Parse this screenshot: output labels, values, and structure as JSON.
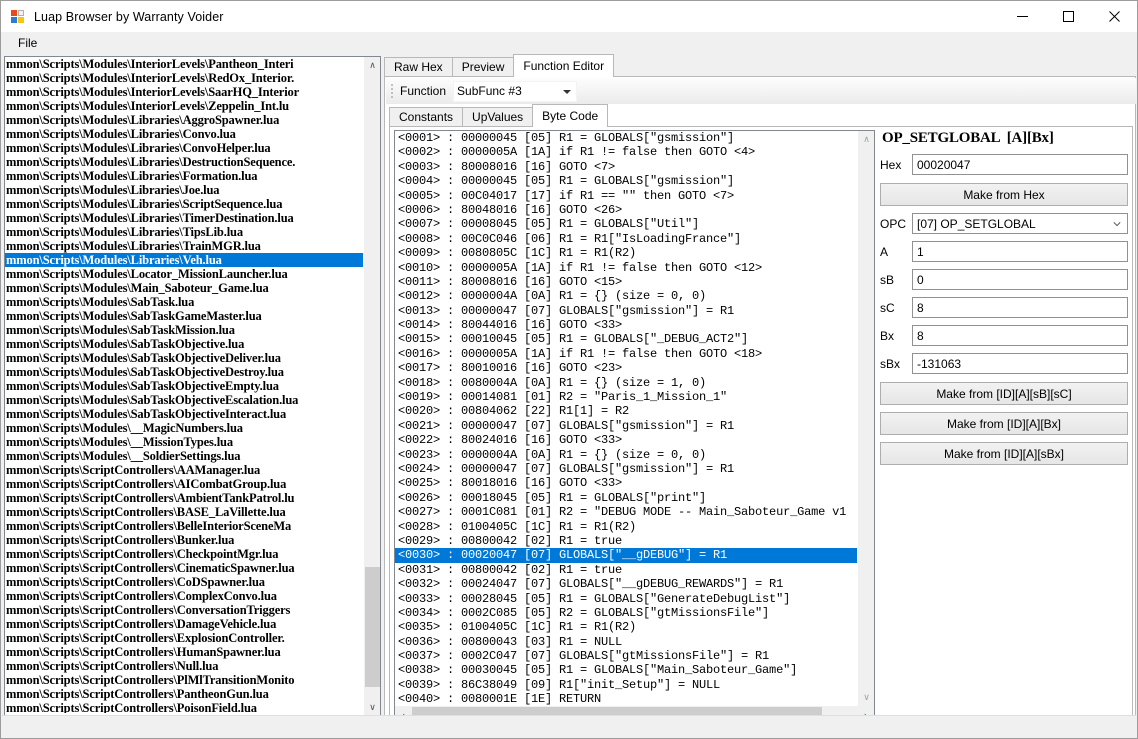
{
  "window": {
    "title": "Luap Browser by Warranty Voider",
    "icon": "app-window-icon",
    "minimize": "—",
    "maximize": "☐",
    "close": "✕"
  },
  "menubar": {
    "items": [
      {
        "label": "File"
      }
    ]
  },
  "filelist": {
    "selected_index": 14,
    "items": [
      "mmon\\Scripts\\Modules\\InteriorLevels\\Pantheon_Interi",
      "mmon\\Scripts\\Modules\\InteriorLevels\\RedOx_Interior.",
      "mmon\\Scripts\\Modules\\InteriorLevels\\SaarHQ_Interior",
      "mmon\\Scripts\\Modules\\InteriorLevels\\Zeppelin_Int.lu",
      "mmon\\Scripts\\Modules\\Libraries\\AggroSpawner.lua",
      "mmon\\Scripts\\Modules\\Libraries\\Convo.lua",
      "mmon\\Scripts\\Modules\\Libraries\\ConvoHelper.lua",
      "mmon\\Scripts\\Modules\\Libraries\\DestructionSequence.",
      "mmon\\Scripts\\Modules\\Libraries\\Formation.lua",
      "mmon\\Scripts\\Modules\\Libraries\\Joe.lua",
      "mmon\\Scripts\\Modules\\Libraries\\ScriptSequence.lua",
      "mmon\\Scripts\\Modules\\Libraries\\TimerDestination.lua",
      "mmon\\Scripts\\Modules\\Libraries\\TipsLib.lua",
      "mmon\\Scripts\\Modules\\Libraries\\TrainMGR.lua",
      "mmon\\Scripts\\Modules\\Libraries\\Veh.lua",
      "mmon\\Scripts\\Modules\\Locator_MissionLauncher.lua",
      "mmon\\Scripts\\Modules\\Main_Saboteur_Game.lua",
      "mmon\\Scripts\\Modules\\SabTask.lua",
      "mmon\\Scripts\\Modules\\SabTaskGameMaster.lua",
      "mmon\\Scripts\\Modules\\SabTaskMission.lua",
      "mmon\\Scripts\\Modules\\SabTaskObjective.lua",
      "mmon\\Scripts\\Modules\\SabTaskObjectiveDeliver.lua",
      "mmon\\Scripts\\Modules\\SabTaskObjectiveDestroy.lua",
      "mmon\\Scripts\\Modules\\SabTaskObjectiveEmpty.lua",
      "mmon\\Scripts\\Modules\\SabTaskObjectiveEscalation.lua",
      "mmon\\Scripts\\Modules\\SabTaskObjectiveInteract.lua",
      "mmon\\Scripts\\Modules\\__MagicNumbers.lua",
      "mmon\\Scripts\\Modules\\__MissionTypes.lua",
      "mmon\\Scripts\\Modules\\__SoldierSettings.lua",
      "mmon\\Scripts\\ScriptControllers\\AAManager.lua",
      "mmon\\Scripts\\ScriptControllers\\AICombatGroup.lua",
      "mmon\\Scripts\\ScriptControllers\\AmbientTankPatrol.lu",
      "mmon\\Scripts\\ScriptControllers\\BASE_LaVillette.lua",
      "mmon\\Scripts\\ScriptControllers\\BelleInteriorSceneMa",
      "mmon\\Scripts\\ScriptControllers\\Bunker.lua",
      "mmon\\Scripts\\ScriptControllers\\CheckpointMgr.lua",
      "mmon\\Scripts\\ScriptControllers\\CinematicSpawner.lua",
      "mmon\\Scripts\\ScriptControllers\\CoDSpawner.lua",
      "mmon\\Scripts\\ScriptControllers\\ComplexConvo.lua",
      "mmon\\Scripts\\ScriptControllers\\ConversationTriggers",
      "mmon\\Scripts\\ScriptControllers\\DamageVehicle.lua",
      "mmon\\Scripts\\ScriptControllers\\ExplosionController.",
      "mmon\\Scripts\\ScriptControllers\\HumanSpawner.lua",
      "mmon\\Scripts\\ScriptControllers\\Null.lua",
      "mmon\\Scripts\\ScriptControllers\\PlMlTransitionMonito",
      "mmon\\Scripts\\ScriptControllers\\PantheonGun.lua",
      "mmon\\Scripts\\ScriptControllers\\PoisonField.lua"
    ]
  },
  "outer_tabs": {
    "items": [
      {
        "label": "Raw Hex",
        "active": false
      },
      {
        "label": "Preview",
        "active": false
      },
      {
        "label": "Function Editor",
        "active": true
      }
    ]
  },
  "function_strip": {
    "label": "Function",
    "selected": "SubFunc #3"
  },
  "inner_tabs": {
    "items": [
      {
        "label": "Constants",
        "active": false
      },
      {
        "label": "UpValues",
        "active": false
      },
      {
        "label": "Byte Code",
        "active": true
      }
    ]
  },
  "bytecode": {
    "selected_index": 29,
    "lines": [
      "<0001> : 00000045 [05] R1 = GLOBALS[\"gsmission\"]",
      "<0002> : 0000005A [1A] if R1 != false then GOTO <4>",
      "<0003> : 80008016 [16] GOTO <7>",
      "<0004> : 00000045 [05] R1 = GLOBALS[\"gsmission\"]",
      "<0005> : 00C04017 [17] if R1 == \"\" then GOTO <7>",
      "<0006> : 80048016 [16] GOTO <26>",
      "<0007> : 00008045 [05] R1 = GLOBALS[\"Util\"]",
      "<0008> : 00C0C046 [06] R1 = R1[\"IsLoadingFrance\"]",
      "<0009> : 0080805C [1C] R1 = R1(R2)",
      "<0010> : 0000005A [1A] if R1 != false then GOTO <12>",
      "<0011> : 80008016 [16] GOTO <15>",
      "<0012> : 0000004A [0A] R1 = {} (size = 0, 0)",
      "<0013> : 00000047 [07] GLOBALS[\"gsmission\"] = R1",
      "<0014> : 80044016 [16] GOTO <33>",
      "<0015> : 00010045 [05] R1 = GLOBALS[\"_DEBUG_ACT2\"]",
      "<0016> : 0000005A [1A] if R1 != false then GOTO <18>",
      "<0017> : 80010016 [16] GOTO <23>",
      "<0018> : 0080004A [0A] R1 = {} (size = 1, 0)",
      "<0019> : 00014081 [01] R2 = \"Paris_1_Mission_1\"",
      "<0020> : 00804062 [22] R1[1] = R2",
      "<0021> : 00000047 [07] GLOBALS[\"gsmission\"] = R1",
      "<0022> : 80024016 [16] GOTO <33>",
      "<0023> : 0000004A [0A] R1 = {} (size = 0, 0)",
      "<0024> : 00000047 [07] GLOBALS[\"gsmission\"] = R1",
      "<0025> : 80018016 [16] GOTO <33>",
      "<0026> : 00018045 [05] R1 = GLOBALS[\"print\"]",
      "<0027> : 0001C081 [01] R2 = \"DEBUG MODE -- Main_Saboteur_Game v1",
      "<0028> : 0100405C [1C] R1 = R1(R2)",
      "<0029> : 00800042 [02] R1 = true",
      "<0030> : 00020047 [07] GLOBALS[\"__gDEBUG\"] = R1",
      "<0031> : 00800042 [02] R1 = true",
      "<0032> : 00024047 [07] GLOBALS[\"__gDEBUG_REWARDS\"] = R1",
      "<0033> : 00028045 [05] R1 = GLOBALS[\"GenerateDebugList\"]",
      "<0034> : 0002C085 [05] R2 = GLOBALS[\"gtMissionsFile\"]",
      "<0035> : 0100405C [1C] R1 = R1(R2)",
      "<0036> : 00800043 [03] R1 = NULL",
      "<0037> : 0002C047 [07] GLOBALS[\"gtMissionsFile\"] = R1",
      "<0038> : 00030045 [05] R1 = GLOBALS[\"Main_Saboteur_Game\"]",
      "<0039> : 86C38049 [09] R1[\"init_Setup\"] = NULL",
      "<0040> : 0080001E [1E] RETURN"
    ]
  },
  "opeditor": {
    "title": "OP_SETGLOBAL  [A][Bx]",
    "fields": [
      {
        "label": "Hex",
        "value": "00020047",
        "kind": "text"
      },
      {
        "label": "OPC",
        "value": "[07] OP_SETGLOBAL",
        "kind": "combo"
      },
      {
        "label": "A",
        "value": "1",
        "kind": "text"
      },
      {
        "label": "sB",
        "value": "0",
        "kind": "text"
      },
      {
        "label": "sC",
        "value": "8",
        "kind": "text"
      },
      {
        "label": "Bx",
        "value": "8",
        "kind": "text"
      },
      {
        "label": "sBx",
        "value": "-131063",
        "kind": "text"
      }
    ],
    "buttons": {
      "make_from_hex": "Make from Hex",
      "make_a_sb_sc": "Make from [ID][A][sB][sC]",
      "make_a_bx": "Make from [ID][A][Bx]",
      "make_a_sbx": "Make from [ID][A][sBx]"
    }
  },
  "scroll_icons": {
    "up": "∧",
    "down": "∨",
    "left": "‹",
    "right": "›"
  },
  "colors": {
    "selection": "#0078d7",
    "selection_text": "#ffffff",
    "window_bg": "#f0f0f0",
    "panel_bg": "#ffffff"
  }
}
